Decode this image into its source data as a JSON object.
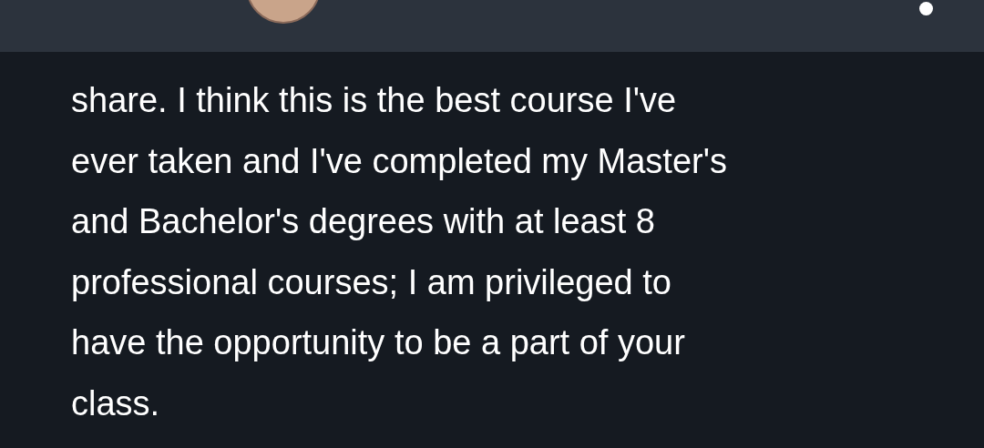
{
  "message": {
    "lines": [
      "share. I think this is the best course I've",
      "ever taken and I've completed my Master's",
      "and Bachelor's degrees with at least 8",
      "professional courses; I am privileged to",
      "have the opportunity to be a part of your",
      "class."
    ]
  }
}
